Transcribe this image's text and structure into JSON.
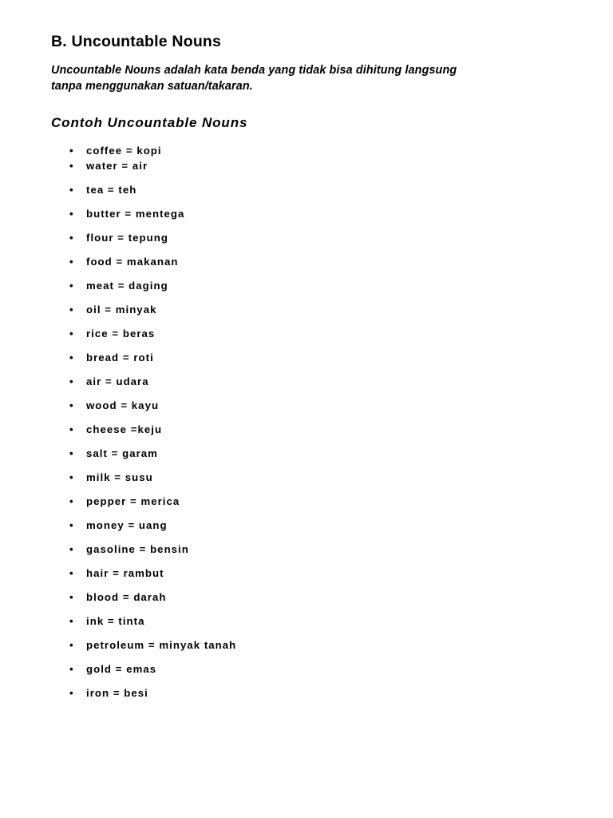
{
  "document": {
    "section_heading": "B. Uncountable Nouns",
    "intro_paragraph_line1": "Uncountable  Nouns adalah kata  benda  yang  tidak  bisa  dihitung langsung",
    "intro_paragraph_line2": "tanpa menggunakan satuan/takaran.",
    "subheading": "Contoh Uncountable Nouns",
    "list": {
      "items": [
        {
          "text": "coffee = kopi",
          "tight": true
        },
        {
          "text": "water = air",
          "tight": false
        },
        {
          "text": "tea = teh",
          "tight": false
        },
        {
          "text": "butter = mentega",
          "tight": false
        },
        {
          "text": "flour = tepung",
          "tight": false
        },
        {
          "text": "food = makanan",
          "tight": false
        },
        {
          "text": "meat = daging",
          "tight": false
        },
        {
          "text": "oil = minyak",
          "tight": false
        },
        {
          "text": "rice = beras",
          "tight": false
        },
        {
          "text": "bread = roti",
          "tight": false
        },
        {
          "text": "air = udara",
          "tight": false
        },
        {
          "text": "wood = kayu",
          "tight": false
        },
        {
          "text": "cheese =keju",
          "tight": false
        },
        {
          "text": "salt = garam",
          "tight": false
        },
        {
          "text": "milk = susu",
          "tight": false
        },
        {
          "text": "pepper = merica",
          "tight": false
        },
        {
          "text": "money = uang",
          "tight": false
        },
        {
          "text": "gasoline = bensin",
          "tight": false
        },
        {
          "text": "hair = rambut",
          "tight": false
        },
        {
          "text": "blood = darah",
          "tight": false
        },
        {
          "text": "ink = tinta",
          "tight": false
        },
        {
          "text": "petroleum = minyak tanah",
          "tight": false
        },
        {
          "text": "gold = emas",
          "tight": false
        },
        {
          "text": "iron = besi",
          "tight": false
        }
      ]
    }
  },
  "colors": {
    "page_background": "#ffffff",
    "text": "#000000"
  }
}
